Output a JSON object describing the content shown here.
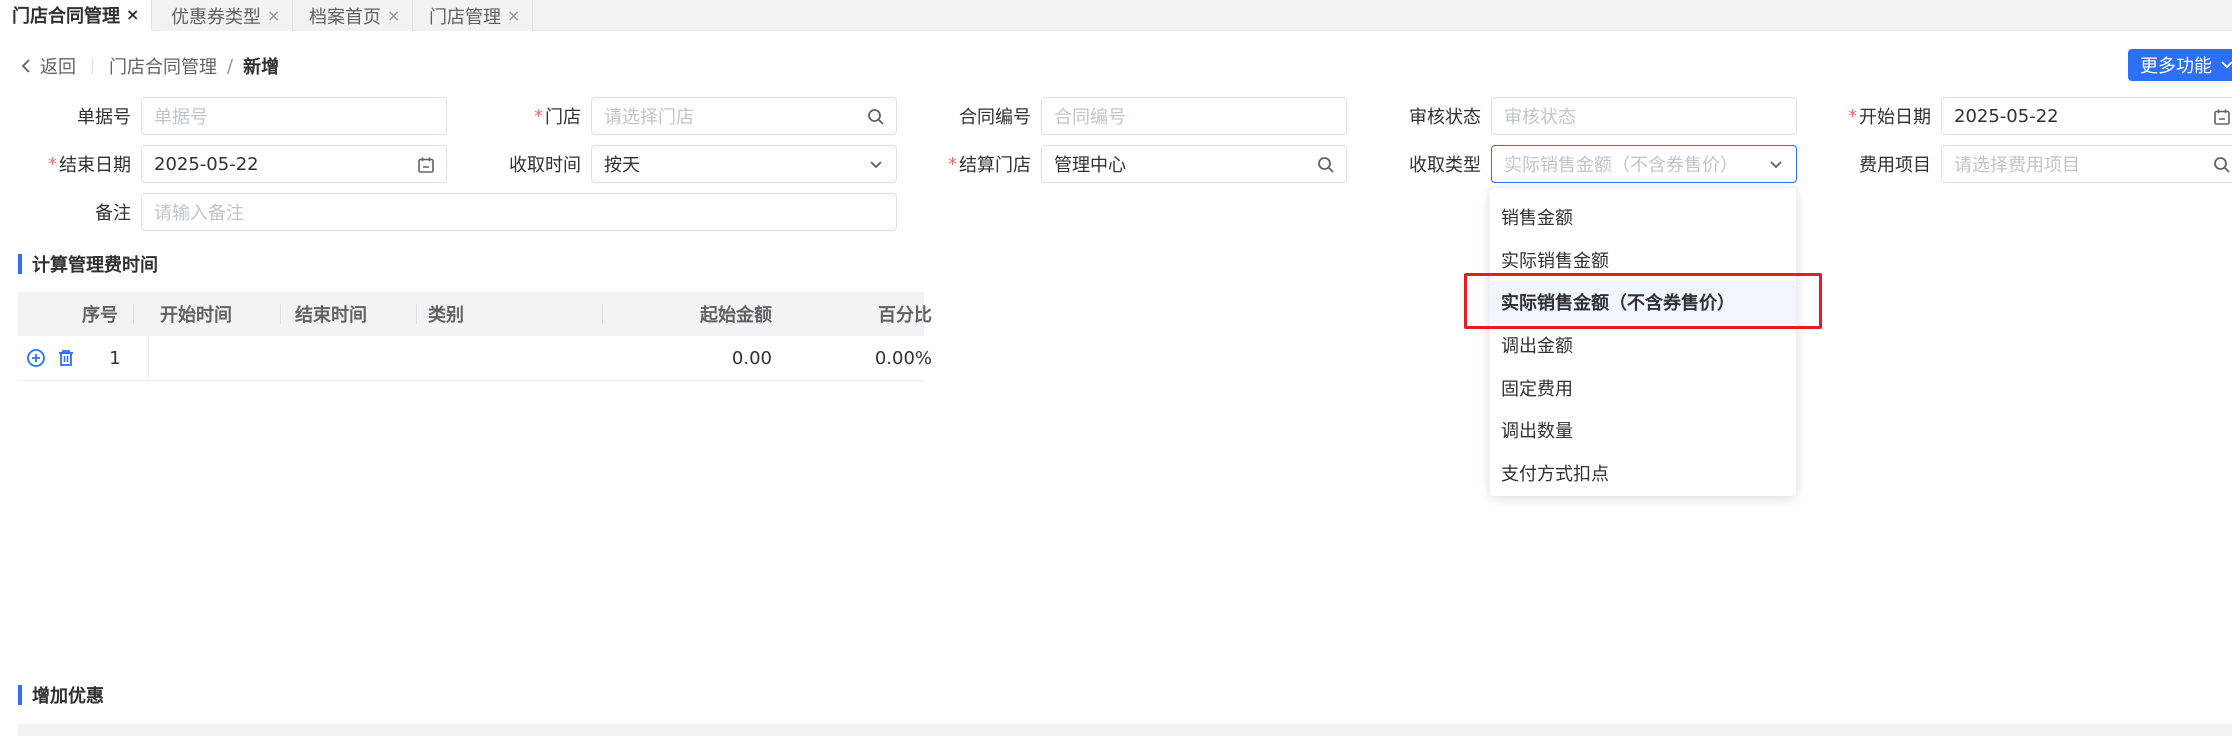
{
  "tabs": [
    {
      "label": "门店合同管理",
      "active": true
    },
    {
      "label": "优惠券类型",
      "active": false
    },
    {
      "label": "档案首页",
      "active": false
    },
    {
      "label": "门店管理",
      "active": false
    }
  ],
  "tab_close": "×",
  "breadcrumb": {
    "back": "返回",
    "parent": "门店合同管理",
    "slash": "/",
    "current": "新增"
  },
  "more_button": "更多功能",
  "form": {
    "doc_no": {
      "label": "单据号",
      "placeholder": "单据号"
    },
    "store": {
      "required": "*",
      "label": "门店",
      "placeholder": "请选择门店"
    },
    "contract_no": {
      "label": "合同编号",
      "placeholder": "合同编号"
    },
    "audit_status": {
      "label": "审核状态",
      "placeholder": "审核状态"
    },
    "start_date": {
      "required": "*",
      "label": "开始日期",
      "value": "2025-05-22"
    },
    "end_date": {
      "required": "*",
      "label": "结束日期",
      "value": "2025-05-22"
    },
    "collect_time": {
      "label": "收取时间",
      "value": "按天"
    },
    "settle_store": {
      "required": "*",
      "label": "结算门店",
      "value": "管理中心"
    },
    "collect_type": {
      "label": "收取类型",
      "placeholder": "实际销售金额（不含券售价）"
    },
    "fee_item": {
      "label": "费用项目",
      "placeholder": "请选择费用项目"
    },
    "remark": {
      "label": "备注",
      "placeholder": "请输入备注"
    }
  },
  "section_fee": "计算管理费时间",
  "table": {
    "columns": [
      "序号",
      "开始时间",
      "结束时间",
      "类别",
      "起始金额",
      "百分比"
    ],
    "rows": [
      {
        "index": "1",
        "start": "",
        "end": "",
        "category": "",
        "amount": "0.00",
        "percent": "0.00%"
      }
    ]
  },
  "section_discount": "增加优惠",
  "dropdown": {
    "options": [
      "销售金额",
      "实际销售金额",
      "实际销售金额（不含券售价）",
      "调出金额",
      "固定费用",
      "调出数量",
      "支付方式扣点"
    ],
    "selected": "实际销售金额（不含券售价）"
  },
  "colors": {
    "primary": "#2d6ff5",
    "highlight": "#e02020",
    "required": "#f56c6c"
  }
}
